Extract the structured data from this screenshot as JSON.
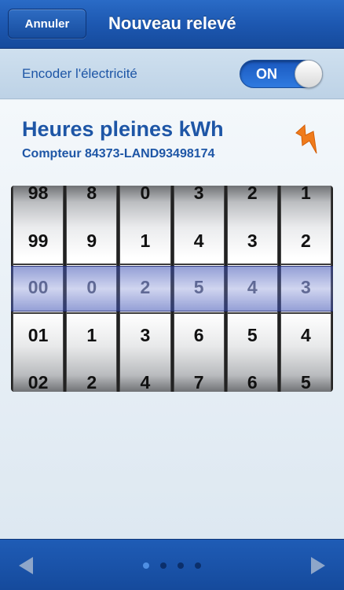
{
  "navbar": {
    "cancel_label": "Annuler",
    "title": "Nouveau relevé"
  },
  "toggle": {
    "label": "Encoder l'électricité",
    "state": "ON"
  },
  "meter": {
    "title": "Heures pleines kWh",
    "subtitle": "Compteur 84373-LAND93498174",
    "icon": "lightning-bolt-icon",
    "wheels": [
      {
        "rows": [
          "98",
          "99",
          "00",
          "01",
          "02"
        ]
      },
      {
        "rows": [
          "8",
          "9",
          "0",
          "1",
          "2"
        ]
      },
      {
        "rows": [
          "0",
          "1",
          "2",
          "3",
          "4"
        ]
      },
      {
        "rows": [
          "3",
          "4",
          "5",
          "6",
          "7"
        ]
      },
      {
        "rows": [
          "2",
          "3",
          "4",
          "5",
          "6"
        ]
      },
      {
        "rows": [
          "1",
          "2",
          "3",
          "4",
          "5"
        ]
      }
    ]
  },
  "toolbar": {
    "prev_icon": "left-arrow-icon",
    "next_icon": "right-arrow-icon",
    "page_count": 4,
    "active_page": 1
  },
  "colors": {
    "accent": "#1e56a6",
    "nav_blue": "#1d58b1",
    "bolt_orange": "#f07b1b"
  }
}
